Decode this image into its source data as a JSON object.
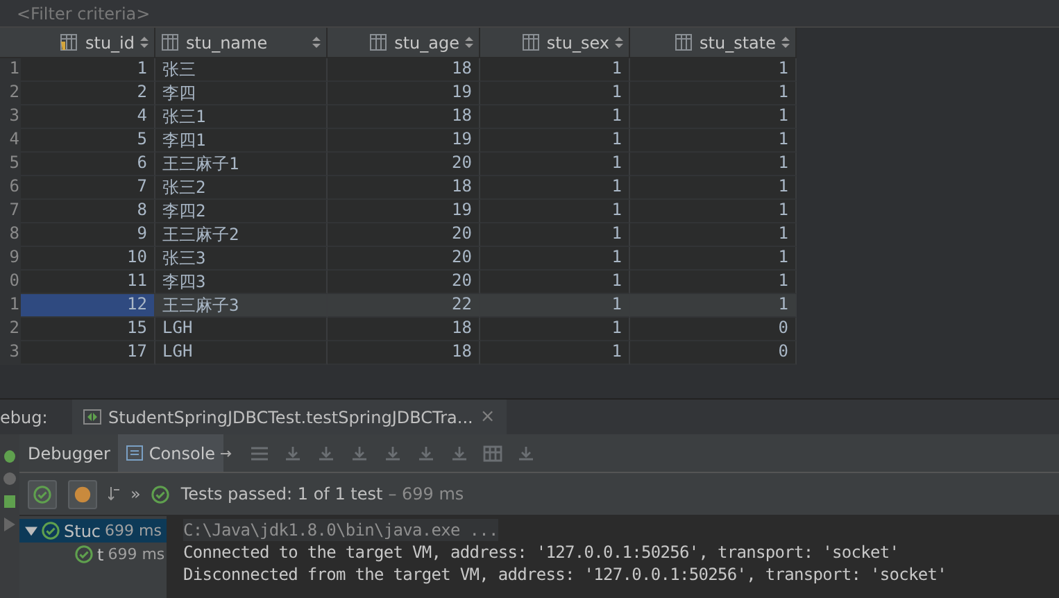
{
  "filter": {
    "placeholder": "<Filter criteria>"
  },
  "table": {
    "columns": [
      {
        "label": "stu_id",
        "primary_key": true,
        "kind": "number"
      },
      {
        "label": "stu_name",
        "primary_key": false,
        "kind": "text"
      },
      {
        "label": "stu_age",
        "primary_key": false,
        "kind": "number"
      },
      {
        "label": "stu_sex",
        "primary_key": false,
        "kind": "number"
      },
      {
        "label": "stu_state",
        "primary_key": false,
        "kind": "number"
      }
    ],
    "rows": [
      {
        "num": "1",
        "selected": false,
        "cells": [
          "1",
          "张三",
          "18",
          "1",
          "1"
        ]
      },
      {
        "num": "2",
        "selected": false,
        "cells": [
          "2",
          "李四",
          "19",
          "1",
          "1"
        ]
      },
      {
        "num": "3",
        "selected": false,
        "cells": [
          "4",
          "张三1",
          "18",
          "1",
          "1"
        ]
      },
      {
        "num": "4",
        "selected": false,
        "cells": [
          "5",
          "李四1",
          "19",
          "1",
          "1"
        ]
      },
      {
        "num": "5",
        "selected": false,
        "cells": [
          "6",
          "王三麻子1",
          "20",
          "1",
          "1"
        ]
      },
      {
        "num": "6",
        "selected": false,
        "cells": [
          "7",
          "张三2",
          "18",
          "1",
          "1"
        ]
      },
      {
        "num": "7",
        "selected": false,
        "cells": [
          "8",
          "李四2",
          "19",
          "1",
          "1"
        ]
      },
      {
        "num": "8",
        "selected": false,
        "cells": [
          "9",
          "王三麻子2",
          "20",
          "1",
          "1"
        ]
      },
      {
        "num": "9",
        "selected": false,
        "cells": [
          "10",
          "张三3",
          "20",
          "1",
          "1"
        ]
      },
      {
        "num": "0",
        "selected": false,
        "cells": [
          "11",
          "李四3",
          "20",
          "1",
          "1"
        ]
      },
      {
        "num": "1",
        "selected": true,
        "cells": [
          "12",
          "王三麻子3",
          "22",
          "1",
          "1"
        ]
      },
      {
        "num": "2",
        "selected": false,
        "cells": [
          "15",
          "LGH",
          "18",
          "1",
          "0"
        ]
      },
      {
        "num": "3",
        "selected": false,
        "cells": [
          "17",
          "LGH",
          "18",
          "1",
          "0"
        ]
      }
    ]
  },
  "debug": {
    "label": "ebug:",
    "tab": "StudentSpringJDBCTest.testSpringJDBCTra...",
    "close": "×"
  },
  "toolbar": {
    "tabs": [
      {
        "label": "Debugger",
        "selected": false
      },
      {
        "label": "Console",
        "selected": true
      }
    ]
  },
  "test_bar": {
    "more": "»",
    "status": "Tests passed: 1 of 1 test",
    "time": "– 699 ms"
  },
  "tree": [
    {
      "label": "Stuc",
      "time": "699 ms",
      "selected": true,
      "expanded": true,
      "children": [
        {
          "label": "t",
          "time": "699 ms",
          "selected": false
        }
      ]
    }
  ],
  "console": [
    {
      "kind": "command",
      "text": "C:\\Java\\jdk1.8.0\\bin\\java.exe ..."
    },
    {
      "kind": "output",
      "text": "Connected to the target VM, address: '127.0.0.1:50256', transport: 'socket'"
    },
    {
      "kind": "output",
      "text": "Disconnected from the target VM, address: '127.0.0.1:50256', transport: 'socket'"
    }
  ]
}
